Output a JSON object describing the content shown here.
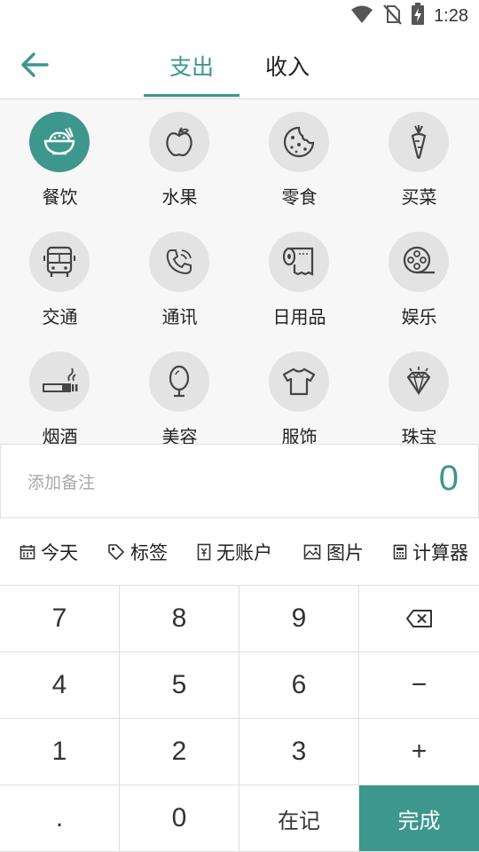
{
  "status_bar": {
    "time": "1:28",
    "icons": [
      "wifi-icon",
      "no-sim-icon",
      "battery-charging-icon"
    ]
  },
  "header": {
    "back_icon": "arrow-left-icon",
    "tabs": [
      {
        "label": "支出",
        "active": true
      },
      {
        "label": "收入",
        "active": false
      }
    ]
  },
  "categories": [
    {
      "label": "餐饮",
      "icon": "rice-bowl-icon",
      "selected": true
    },
    {
      "label": "水果",
      "icon": "apple-icon",
      "selected": false
    },
    {
      "label": "零食",
      "icon": "cookie-icon",
      "selected": false
    },
    {
      "label": "买菜",
      "icon": "carrot-icon",
      "selected": false
    },
    {
      "label": "交通",
      "icon": "bus-icon",
      "selected": false
    },
    {
      "label": "通讯",
      "icon": "phone-icon",
      "selected": false
    },
    {
      "label": "日用品",
      "icon": "toilet-paper-icon",
      "selected": false
    },
    {
      "label": "娱乐",
      "icon": "film-reel-icon",
      "selected": false
    },
    {
      "label": "烟酒",
      "icon": "cigarette-icon",
      "selected": false
    },
    {
      "label": "美容",
      "icon": "mirror-icon",
      "selected": false
    },
    {
      "label": "服饰",
      "icon": "tshirt-icon",
      "selected": false
    },
    {
      "label": "珠宝",
      "icon": "diamond-icon",
      "selected": false
    }
  ],
  "note": {
    "placeholder": "添加备注",
    "value": "",
    "amount": "0"
  },
  "toolbar": [
    {
      "label": "今天",
      "icon": "calendar-icon"
    },
    {
      "label": "标签",
      "icon": "tag-icon"
    },
    {
      "label": "无账户",
      "icon": "wallet-icon"
    },
    {
      "label": "图片",
      "icon": "image-icon"
    },
    {
      "label": "计算器",
      "icon": "calculator-icon"
    }
  ],
  "keypad": {
    "rows": [
      [
        "7",
        "8",
        "9",
        "backspace"
      ],
      [
        "4",
        "5",
        "6",
        "−"
      ],
      [
        "1",
        "2",
        "3",
        "+"
      ],
      [
        ".",
        "0",
        "在记",
        "完成"
      ]
    ],
    "backspace_icon": "backspace-icon"
  },
  "colors": {
    "accent": "#3d978d",
    "category_bg": "#f7f7f7",
    "icon_circle": "#e3e3e3"
  }
}
